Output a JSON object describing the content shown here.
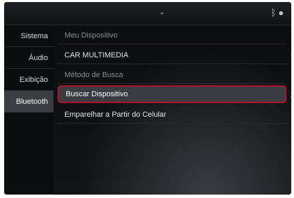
{
  "topbar": {
    "chevron_icon": "chevron-down-icon",
    "status_icons": [
      "bluetooth-icon",
      "status-dot-icon"
    ]
  },
  "sidebar": {
    "items": [
      {
        "label": "Sistema"
      },
      {
        "label": "Áudio"
      },
      {
        "label": "Exibição"
      },
      {
        "label": "Bluetooth",
        "active": true
      }
    ]
  },
  "main": {
    "rows": [
      {
        "label": "Meu Dispositivo",
        "type": "header"
      },
      {
        "label": "CAR MULTIMEDIA",
        "arrow": "chevron-right-icon"
      },
      {
        "label": "Método de Busca",
        "type": "header"
      },
      {
        "label": "Buscar Dispositivo",
        "selected": true,
        "arrow": "chevron-right-icon"
      },
      {
        "label": "Emparelhar a Partir do Celular"
      }
    ]
  },
  "colors": {
    "highlight_border": "#b3122a",
    "active_bg": "#3b3d42",
    "screen_bg": "#0b0c0e"
  }
}
